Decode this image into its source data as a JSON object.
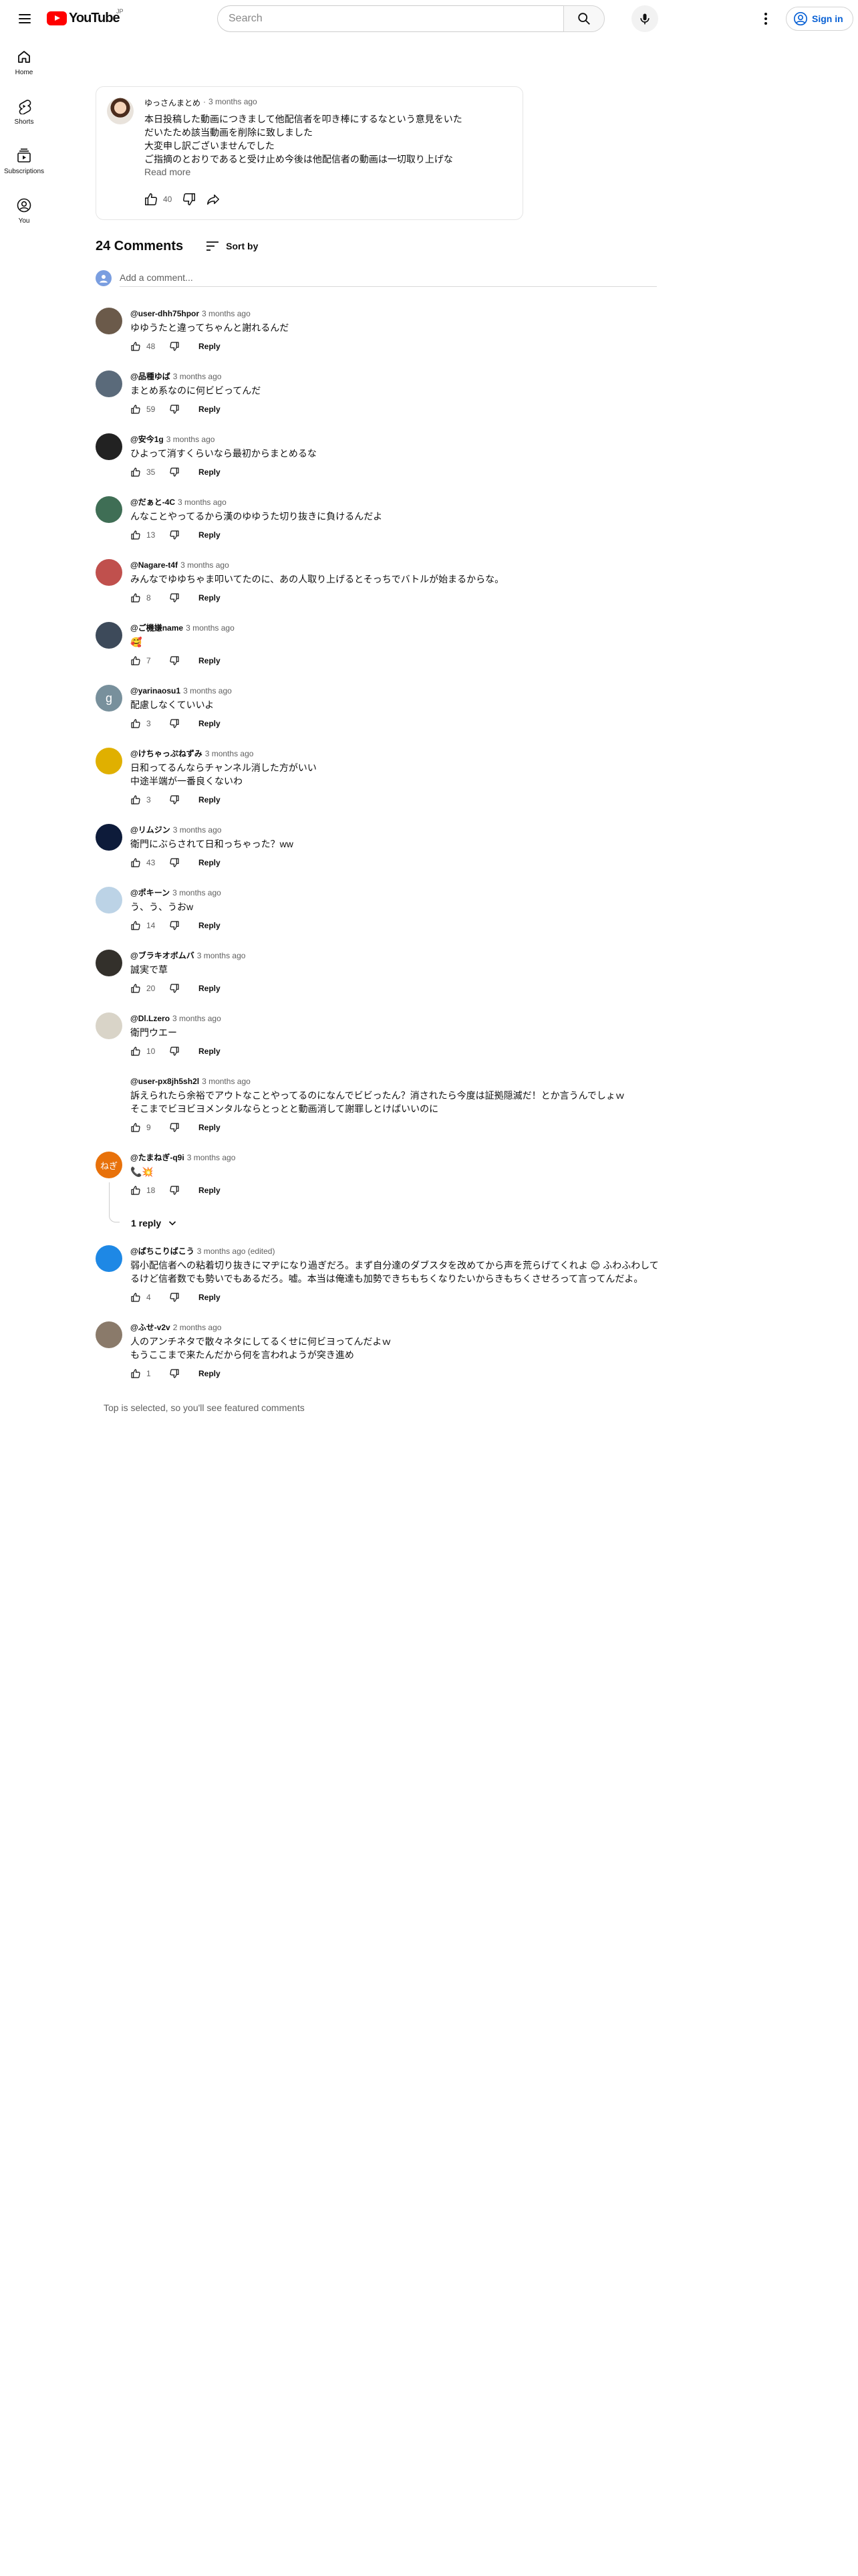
{
  "header": {
    "logo_text": "YouTube",
    "region": "JP",
    "search_placeholder": "Search",
    "signin_label": "Sign in"
  },
  "sidebar": {
    "items": [
      {
        "label": "Home",
        "icon": "home-icon"
      },
      {
        "label": "Shorts",
        "icon": "shorts-icon"
      },
      {
        "label": "Subscriptions",
        "icon": "subscriptions-icon"
      },
      {
        "label": "You",
        "icon": "you-icon"
      }
    ]
  },
  "post": {
    "author": "ゆっさんまとめ",
    "time": "3 months ago",
    "lines": [
      "本日投稿した動画につきまして他配信者を叩き棒にするなという意見をいた",
      "だいたため該当動画を削除に致しました",
      "大変申し訳ございませんでした",
      "ご指摘のとおりであると受け止め今後は他配信者の動画は一切取り上げな"
    ],
    "read_more": "Read more",
    "likes": "40"
  },
  "comments_header": {
    "count": "24 Comments",
    "sort_label": "Sort by",
    "add_placeholder": "Add a comment..."
  },
  "comments": [
    {
      "author": "@user-dhh75hpor",
      "time": "3 months ago",
      "text": [
        "ゆゆうたと違ってちゃんと謝れるんだ"
      ],
      "likes": "48",
      "reply": "Reply",
      "avatar_color": "#6b5a4a"
    },
    {
      "author": "@品種ゆば",
      "time": "3 months ago",
      "text": [
        "まとめ系なのに何ビビってんだ"
      ],
      "likes": "59",
      "reply": "Reply",
      "avatar_color": "#5a6a7a"
    },
    {
      "author": "@安今1g",
      "time": "3 months ago",
      "text": [
        "ひよって消すくらいなら最初からまとめるな"
      ],
      "likes": "35",
      "reply": "Reply",
      "avatar_color": "#222222"
    },
    {
      "author": "@だぁと-4C",
      "time": "3 months ago",
      "text": [
        "んなことやってるから漢のゆゆうた切り抜きに負けるんだよ"
      ],
      "likes": "13",
      "reply": "Reply",
      "avatar_color": "#3f6e55"
    },
    {
      "author": "@Nagare-t4f",
      "time": "3 months ago",
      "text": [
        "みんなでゆゆちゃま叩いてたのに、あの人取り上げるとそっちでバトルが始まるからな。"
      ],
      "likes": "8",
      "reply": "Reply",
      "avatar_color": "#c0504d"
    },
    {
      "author": "@ご機嫌name",
      "time": "3 months ago",
      "text": [
        "🥰"
      ],
      "likes": "7",
      "reply": "Reply",
      "avatar_color": "#3d4a5a"
    },
    {
      "author": "@yarinaosu1",
      "time": "3 months ago",
      "text": [
        "配慮しなくていいよ"
      ],
      "likes": "3",
      "reply": "Reply",
      "avatar_color": "#78909c",
      "avatar_letter": "g"
    },
    {
      "author": "@けちゃっぷねずみ",
      "time": "3 months ago",
      "text": [
        "日和ってるんならチャンネル消した方がいい",
        "中途半端が一番良くないわ"
      ],
      "likes": "3",
      "reply": "Reply",
      "avatar_color": "#e0b000"
    },
    {
      "author": "@リムジン",
      "time": "3 months ago",
      "text": [
        "衛門にぶらされて日和っちゃった？ww"
      ],
      "likes": "43",
      "reply": "Reply",
      "avatar_color": "#0d1b3a"
    },
    {
      "author": "@ポキーン",
      "time": "3 months ago",
      "text": [
        "う、う、うおw"
      ],
      "likes": "14",
      "reply": "Reply",
      "avatar_color": "#bcd3e6"
    },
    {
      "author": "@ブラキオボムバ",
      "time": "3 months ago",
      "text": [
        "誠実で草"
      ],
      "likes": "20",
      "reply": "Reply",
      "avatar_color": "#33302b"
    },
    {
      "author": "@Dl.Lzero",
      "time": "3 months ago",
      "text": [
        "衛門ウエー"
      ],
      "likes": "10",
      "reply": "Reply",
      "avatar_color": "#d9d4c8"
    },
    {
      "author": "@user-px8jh5sh2l",
      "time": "3 months ago",
      "text": [
        "訴えられたら余裕でアウトなことやってるのになんでビビったん？消されたら今度は証拠隠滅だ！とか言うんでしょｗ",
        "そこまでビヨビヨメンタルならとっとと動画消して謝罪しとけばいいのに"
      ],
      "likes": "9",
      "reply": "Reply",
      "avatar_color": ""
    },
    {
      "author": "@たまねぎ-q9i",
      "time": "3 months ago",
      "text": [
        "📞💥"
      ],
      "likes": "18",
      "reply": "Reply",
      "avatar_color": "#e8710a",
      "avatar_letter": "ねぎ"
    },
    {
      "author": "@ぱちこりばこう",
      "time": "3 months ago (edited)",
      "text": [
        "弱小配信者への粘着切り抜きにマヂになり過ぎだろ。まず自分達のダブスタを改めてから声を荒らげてくれよ 😊 ふわふわして",
        "るけど信者数でも勢いでもあるだろ。嘘。本当は俺達も加勢できちもちくなりたいからきもちくさせろって言ってんだよ。"
      ],
      "likes": "4",
      "reply": "Reply",
      "avatar_color": "#1e88e5"
    },
    {
      "author": "@ふせ-v2v",
      "time": "2 months ago",
      "text": [
        "人のアンチネタで散々ネタにしてるくせに何ビヨってんだよｗ",
        "もうここまで来たんだから何を言われようが突き進め"
      ],
      "likes": "1",
      "reply": "Reply",
      "avatar_color": "#8a7a6a"
    }
  ],
  "replies_toggle": "1 reply",
  "footer_note": "Top is selected, so you'll see featured comments"
}
